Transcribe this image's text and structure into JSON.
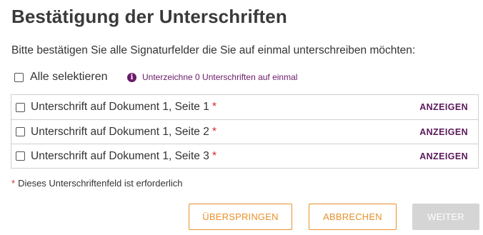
{
  "dialog": {
    "title": "Bestätigung der Unterschriften",
    "instruction": "Bitte bestätigen Sie alle Signaturfelder die Sie auf einmal unterschreiben möchten:"
  },
  "select_all": {
    "label": "Alle selektieren",
    "checked": false
  },
  "info": {
    "icon": "info-icon",
    "text": "Unterzeichne 0 Unterschriften auf einmal"
  },
  "signatures": [
    {
      "label": "Unterschrift auf Dokument 1, Seite 1",
      "required_marker": "*",
      "action": "ANZEIGEN",
      "checked": false
    },
    {
      "label": "Unterschrift auf Dokument 1, Seite 2",
      "required_marker": "*",
      "action": "ANZEIGEN",
      "checked": false
    },
    {
      "label": "Unterschrift auf Dokument 1, Seite 3",
      "required_marker": "*",
      "action": "ANZEIGEN",
      "checked": false
    }
  ],
  "footnote": {
    "marker": "*",
    "text": "Dieses Unterschriftenfeld ist erforderlich"
  },
  "buttons": {
    "skip": "ÜBERSPRINGEN",
    "cancel": "ABBRECHEN",
    "next": "WEITER",
    "next_disabled": true
  },
  "colors": {
    "accent": "#e8912d",
    "info": "#6a1b6a",
    "required": "#d32f2f",
    "disabled": "#d5d5d5"
  }
}
